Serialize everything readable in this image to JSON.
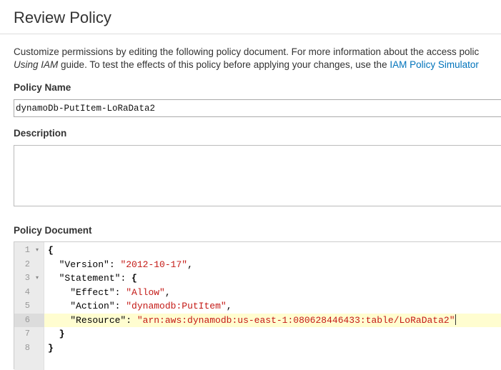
{
  "header": {
    "title": "Review Policy"
  },
  "intro": {
    "line1": "Customize permissions by editing the following policy document. For more information about the access polic",
    "line2_guide": "Using IAM",
    "line2_text": " guide. To test the effects of this policy before applying your changes, use the ",
    "simulator_link": "IAM Policy Simulator"
  },
  "policy_name": {
    "label": "Policy Name",
    "value": "dynamoDb-PutItem-LoRaData2"
  },
  "description": {
    "label": "Description",
    "value": ""
  },
  "policy_document": {
    "label": "Policy Document",
    "line_numbers": [
      "1",
      "2",
      "3",
      "4",
      "5",
      "6",
      "7",
      "8"
    ],
    "fold_marker": "▾",
    "open_brace": "{",
    "close_brace": "}",
    "version_key": "\"Version\"",
    "version_value": "\"2012-10-17\"",
    "statement_key": "\"Statement\"",
    "effect_key": "\"Effect\"",
    "effect_value": "\"Allow\"",
    "action_key": "\"Action\"",
    "action_value": "\"dynamodb:PutItem\"",
    "resource_key": "\"Resource\"",
    "resource_value": "\"arn:aws:dynamodb:us-east-1:080628446433:table/LoRaData2\"",
    "colon": ": ",
    "comma": ","
  }
}
